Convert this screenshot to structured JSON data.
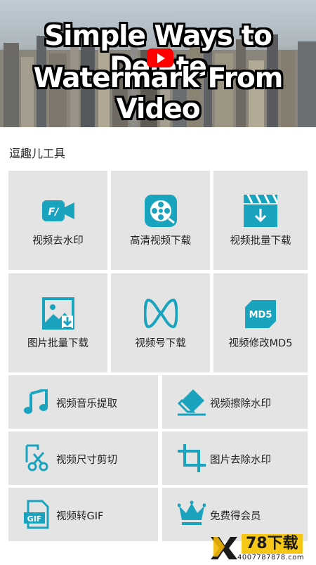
{
  "banner": {
    "line1": "Simple Ways to Delete",
    "line2": "Watermark From Video"
  },
  "section_title": "逗趣儿工具",
  "grid_top": [
    {
      "label": "视频去水印",
      "icon": "video-camera-icon"
    },
    {
      "label": "高清视频下载",
      "icon": "film-reel-icon"
    },
    {
      "label": "视频批量下载",
      "icon": "clapper-download-icon"
    },
    {
      "label": "图片批量下载",
      "icon": "image-download-icon"
    },
    {
      "label": "视频号下载",
      "icon": "infinity-icon"
    },
    {
      "label": "视频修改MD5",
      "icon": "md5-icon"
    }
  ],
  "grid_bottom": [
    {
      "label": "视频音乐提取",
      "icon": "music-note-icon"
    },
    {
      "label": "视频擦除水印",
      "icon": "eraser-icon"
    },
    {
      "label": "视频尺寸剪切",
      "icon": "scissors-icon"
    },
    {
      "label": "图片去除水印",
      "icon": "crop-icon"
    },
    {
      "label": "视频转GIF",
      "icon": "gif-file-icon"
    },
    {
      "label": "免费得会员",
      "icon": "crown-icon"
    }
  ],
  "watermark": {
    "brand": "78下载",
    "domain": "4007787878.com"
  },
  "colors": {
    "accent": "#1aa3bf",
    "tile": "#e4e4e4"
  }
}
